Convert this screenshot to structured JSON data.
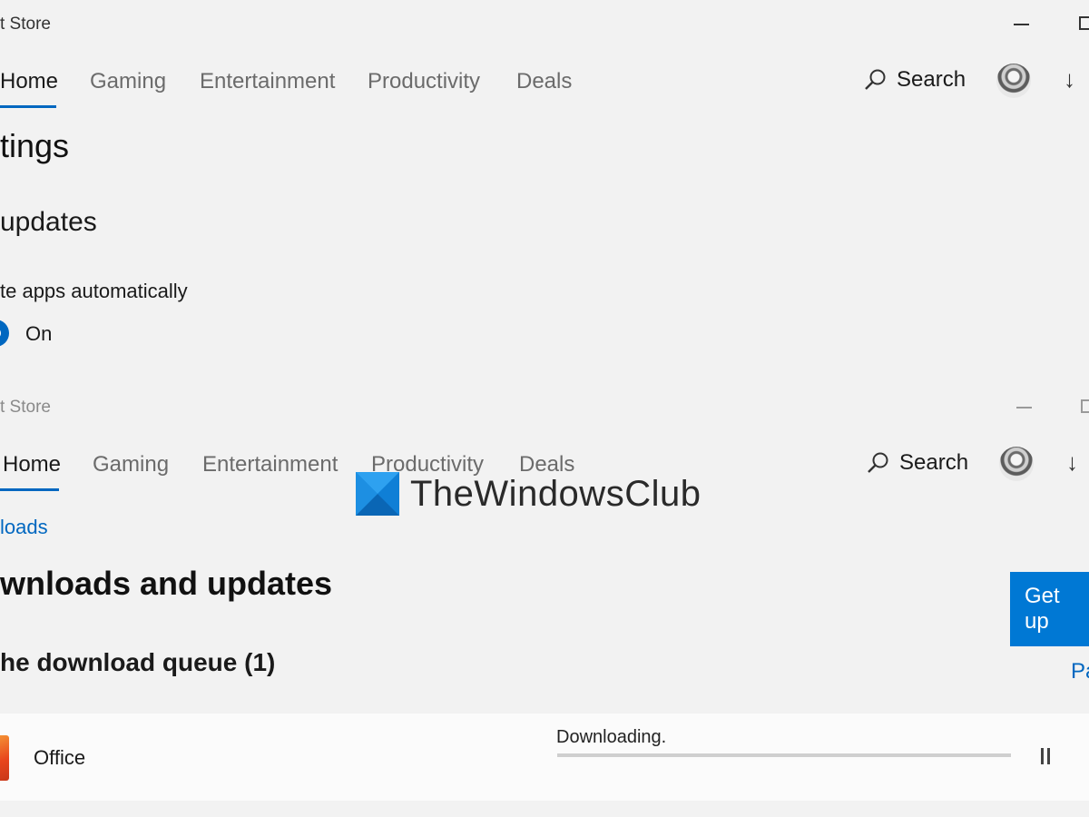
{
  "top_window": {
    "title": "t Store",
    "nav": [
      "Home",
      "Gaming",
      "Entertainment",
      "Productivity",
      "Deals"
    ],
    "search_label": "Search",
    "download_icon": "download-icon",
    "page_title": "tings",
    "section_title": " updates",
    "setting_label": "te apps automatically",
    "toggle_state": "On"
  },
  "bottom_window": {
    "title": "t Store",
    "nav": [
      "Home",
      "Gaming",
      "Entertainment",
      "Productivity",
      "Deals"
    ],
    "search_label": "Search",
    "breadcrumb": "loads",
    "page_title": "wnloads and updates",
    "get_updates_label": "Get up",
    "queue_title": "he download queue (1)",
    "pause_all_link": "Pa",
    "item": {
      "name": "Office",
      "status": "Downloading.",
      "progress": 0.0
    }
  },
  "watermark": {
    "text": "TheWindowsClub"
  },
  "colors": {
    "accent": "#0067c0",
    "button": "#0078d4",
    "background": "#f2f2f2"
  }
}
